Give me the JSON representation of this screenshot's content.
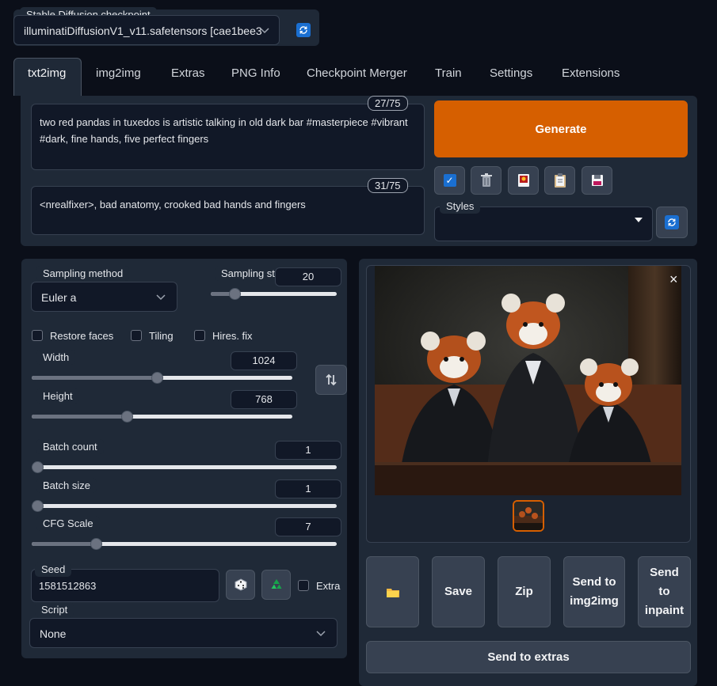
{
  "checkpoint": {
    "label": "Stable Diffusion checkpoint",
    "value": "illuminatiDiffusionV1_v11.safetensors [cae1bee3"
  },
  "tabs": [
    "txt2img",
    "img2img",
    "Extras",
    "PNG Info",
    "Checkpoint Merger",
    "Train",
    "Settings",
    "Extensions"
  ],
  "prompt": {
    "positive": "two red pandas in tuxedos is artistic talking in old dark bar #masterpiece #vibrant #dark, fine hands, five perfect fingers",
    "positive_count": "27/75",
    "negative": "<nrealfixer>, bad anatomy, crooked bad hands and fingers",
    "negative_count": "31/75"
  },
  "generate_label": "Generate",
  "styles_label": "Styles",
  "sampling": {
    "method_label": "Sampling method",
    "method_value": "Euler a",
    "steps_label": "Sampling st",
    "steps_value": "20",
    "steps_fraction": 0.16
  },
  "checks": {
    "restore_faces": "Restore faces",
    "tiling": "Tiling",
    "hires": "Hires. fix",
    "extra": "Extra"
  },
  "width": {
    "label": "Width",
    "value": "1024",
    "fraction": 0.48
  },
  "height": {
    "label": "Height",
    "value": "768",
    "fraction": 0.36
  },
  "batch_count": {
    "label": "Batch count",
    "value": "1",
    "fraction": 0.0
  },
  "batch_size": {
    "label": "Batch size",
    "value": "1",
    "fraction": 0.0
  },
  "cfg": {
    "label": "CFG Scale",
    "value": "7",
    "fraction": 0.2
  },
  "seed": {
    "label": "Seed",
    "value": "1581512863"
  },
  "script": {
    "label": "Script",
    "value": "None"
  },
  "output_buttons": {
    "save": "Save",
    "zip": "Zip",
    "img2img": "Send to img2img",
    "inpaint": "Send to inpaint",
    "extras": "Send to extras"
  },
  "close_glyph": "×",
  "colors": {
    "accent": "#d65f00",
    "background": "#0b0f19",
    "panel": "#1f2937"
  }
}
